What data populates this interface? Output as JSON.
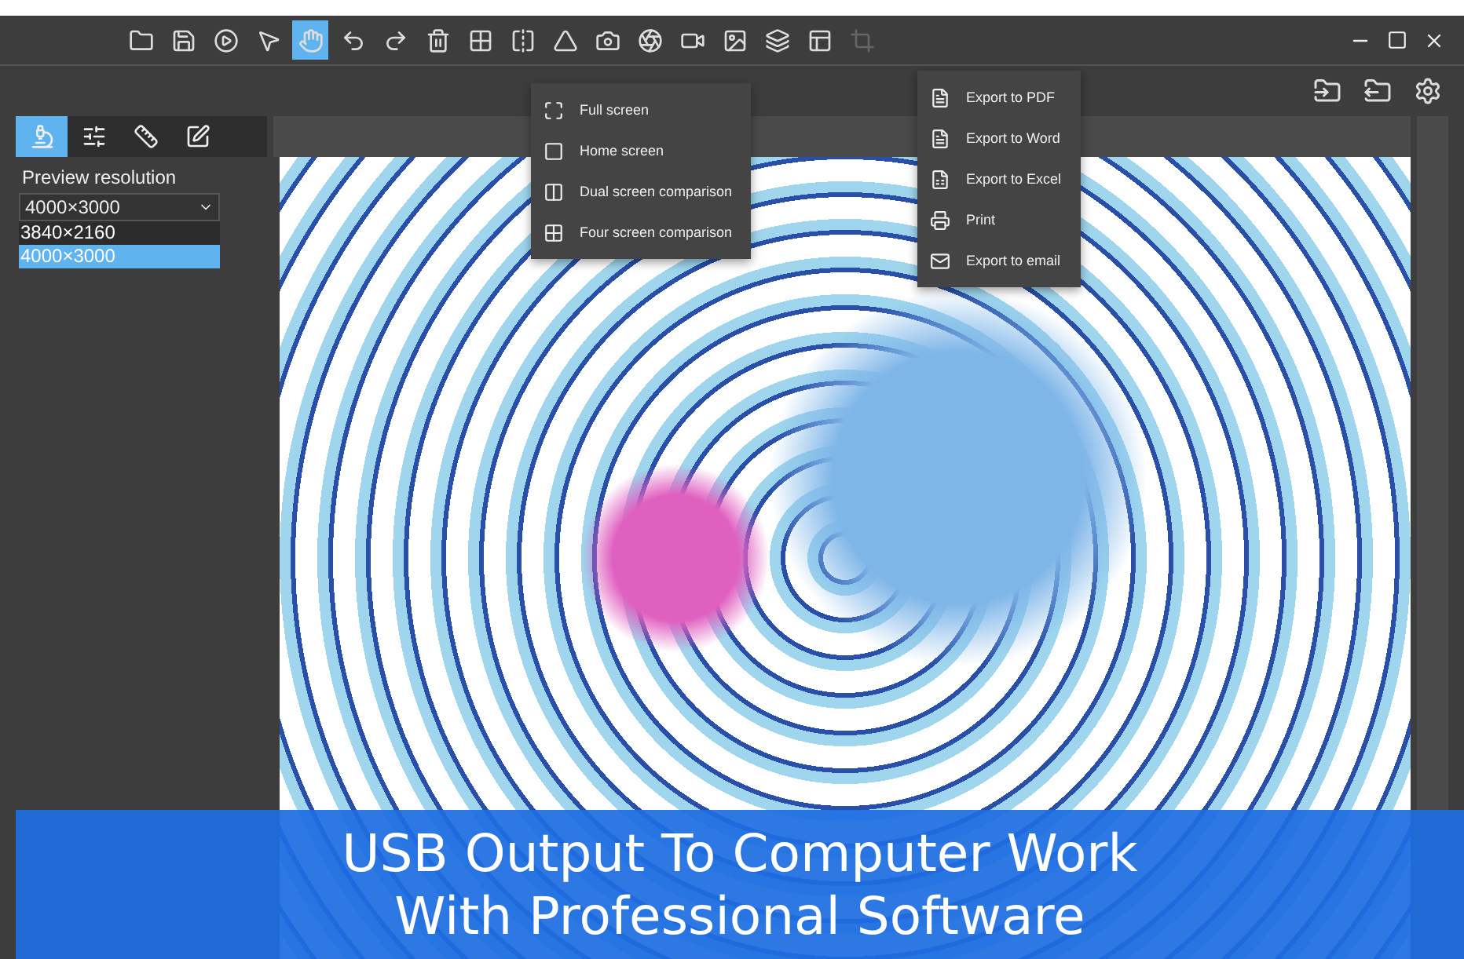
{
  "toolbar": {
    "tools": [
      {
        "kind": "folder",
        "selected": false
      },
      {
        "kind": "save",
        "selected": false
      },
      {
        "kind": "play",
        "selected": false
      },
      {
        "kind": "pointer",
        "selected": false
      },
      {
        "kind": "hand",
        "selected": true
      },
      {
        "kind": "undo",
        "selected": false
      },
      {
        "kind": "redo",
        "selected": false
      },
      {
        "kind": "trash",
        "selected": false
      },
      {
        "kind": "grid",
        "selected": false
      },
      {
        "kind": "flip-h",
        "selected": false
      },
      {
        "kind": "flip-v",
        "selected": false
      },
      {
        "kind": "camera",
        "selected": false
      },
      {
        "kind": "snapshot",
        "selected": false
      },
      {
        "kind": "video",
        "selected": false
      },
      {
        "kind": "image",
        "selected": false
      },
      {
        "kind": "layers",
        "selected": false
      },
      {
        "kind": "panels",
        "selected": false
      },
      {
        "kind": "crop",
        "selected": false,
        "disabled": true
      }
    ]
  },
  "side_tabs": [
    {
      "kind": "microscope",
      "selected": true
    },
    {
      "kind": "sliders",
      "selected": false
    },
    {
      "kind": "ruler",
      "selected": false
    },
    {
      "kind": "edit",
      "selected": false
    }
  ],
  "preview": {
    "label": "Preview resolution",
    "value": "4000×3000",
    "options": [
      {
        "label": "3840×2160",
        "selected": false
      },
      {
        "label": "4000×3000",
        "selected": true
      }
    ]
  },
  "screen_menu": [
    {
      "kind": "full",
      "label": "Full screen"
    },
    {
      "kind": "home",
      "label": "Home screen"
    },
    {
      "kind": "dual",
      "label": "Dual screen comparison"
    },
    {
      "kind": "four",
      "label": "Four screen comparison"
    }
  ],
  "export_menu": [
    {
      "kind": "pdf",
      "label": "Export to PDF"
    },
    {
      "kind": "word",
      "label": "Export to Word"
    },
    {
      "kind": "excel",
      "label": "Export to Excel"
    },
    {
      "kind": "print",
      "label": "Print"
    },
    {
      "kind": "email",
      "label": "Export to email"
    }
  ],
  "banner": {
    "lines": [
      "USB Output To Computer Work",
      "With Professional Software"
    ]
  }
}
